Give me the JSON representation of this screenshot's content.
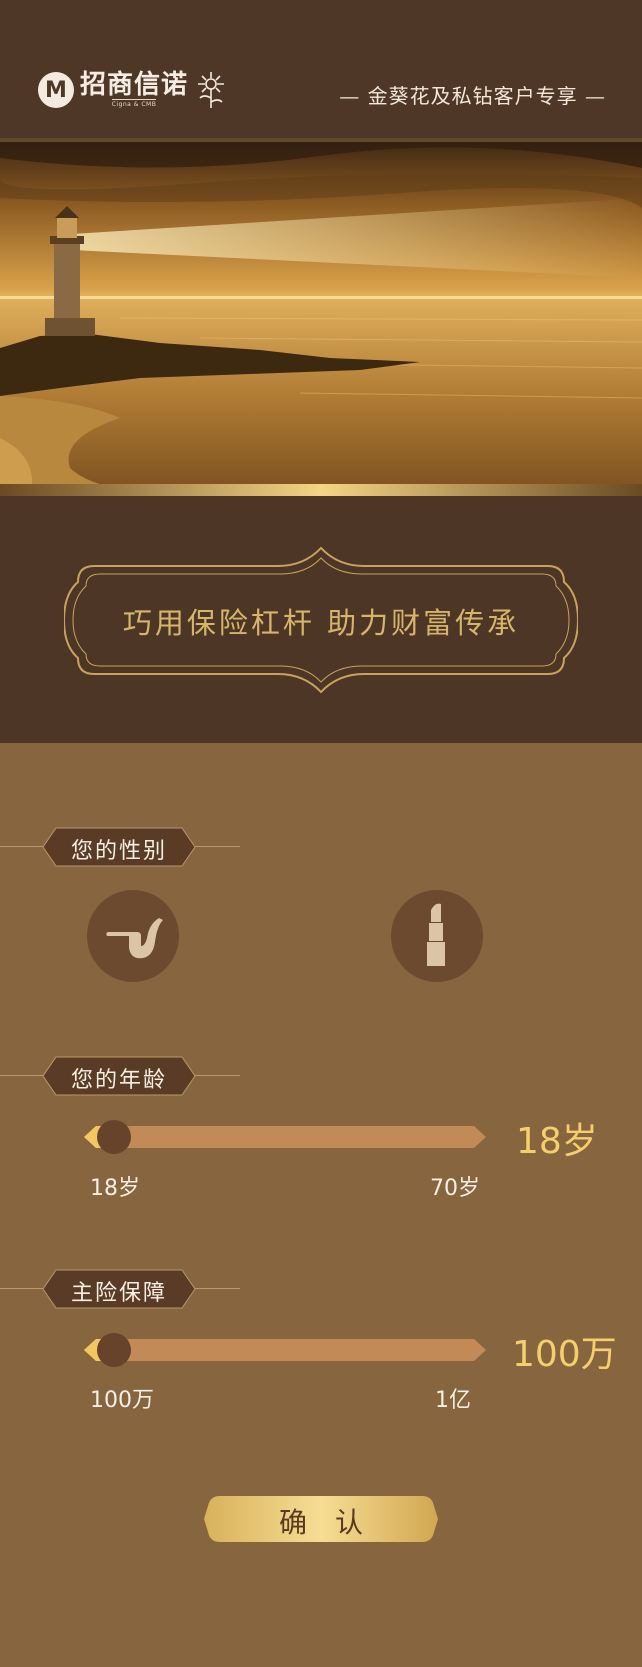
{
  "header": {
    "logo_text": "招商信诺",
    "logo_subtext": "Cigna & CMB",
    "logo_mark": "M",
    "tagline": "— 金葵花及私钻客户专享 —"
  },
  "hero": {
    "alt_icon": "lighthouse-image"
  },
  "banner": {
    "slogan": "巧用保险杠杆  助力财富传承"
  },
  "gender": {
    "label": "您的性别",
    "options": [
      {
        "icon": "pipe-icon",
        "value": "male"
      },
      {
        "icon": "lipstick-icon",
        "value": "female"
      }
    ]
  },
  "age": {
    "label": "您的年龄",
    "min_label": "18岁",
    "max_label": "70岁",
    "current": "18岁",
    "min": 18,
    "max": 70,
    "value": 18
  },
  "coverage": {
    "label": "主险保障",
    "min_label": "100万",
    "max_label": "1亿",
    "current": "100万",
    "value_fraction": 0
  },
  "confirm_label": "确认",
  "colors": {
    "header_bg": "#4f3727",
    "body_bg": "#86653f",
    "accent_gold": "#f5cf6b",
    "track": "#c18a57",
    "thumb": "#66432a"
  }
}
